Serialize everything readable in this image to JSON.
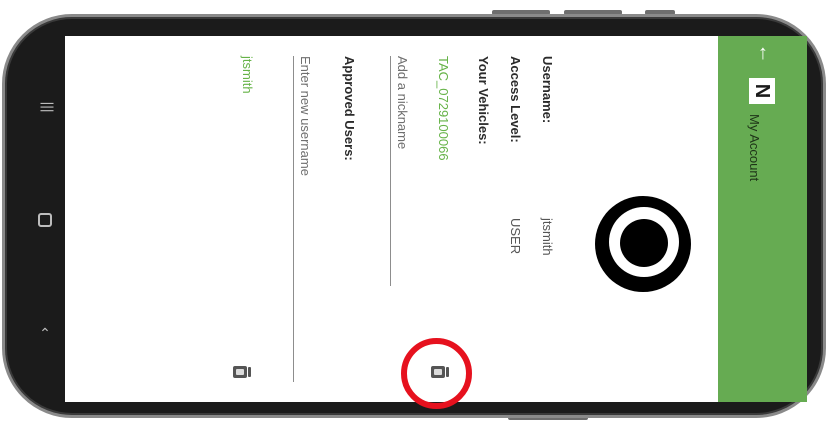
{
  "header": {
    "title": "My Account",
    "back_icon": "back-arrow-icon",
    "logo_text": "N",
    "accent_color": "#66ab52"
  },
  "account": {
    "username_label": "Username:",
    "username_value": "jtsmith",
    "access_level_label": "Access Level:",
    "access_level_value": "USER",
    "vehicles_label": "Your Vehicles:",
    "vehicle_id": "TAC_0729100066",
    "nickname_placeholder": "Add a nickname",
    "approved_users_label": "Approved Users:",
    "new_username_placeholder": "Enter new username",
    "approved_user": "jtsmith",
    "link_color": "#66b348"
  },
  "annotation": {
    "highlight_color": "#e6111e"
  }
}
